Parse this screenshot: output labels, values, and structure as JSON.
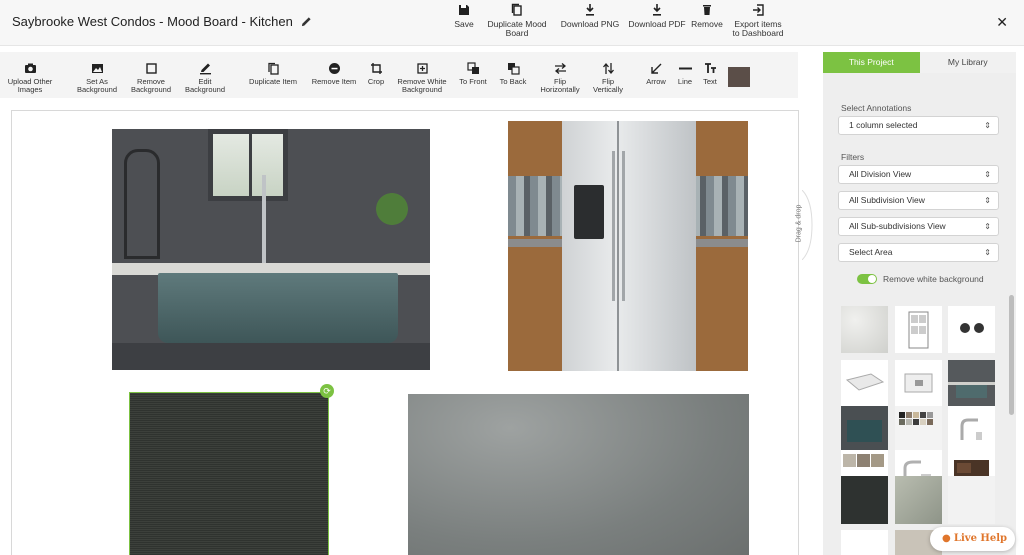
{
  "header": {
    "title": "Saybrooke West Condos - Mood Board - Kitchen",
    "actions": [
      {
        "label": "Save",
        "icon": "save-icon"
      },
      {
        "label": "Duplicate Mood Board",
        "icon": "copy-icon"
      },
      {
        "label": "Download PNG",
        "icon": "download-icon"
      },
      {
        "label": "Download PDF",
        "icon": "download-icon"
      },
      {
        "label": "Remove",
        "icon": "trash-icon"
      },
      {
        "label": "Export items to Dashboard",
        "icon": "export-icon"
      }
    ],
    "close_label": "✕"
  },
  "toolbar": [
    {
      "label": "Upload Other Images",
      "icon": "camera-icon"
    },
    {
      "label": "Set As Background",
      "icon": "image-icon"
    },
    {
      "label": "Remove Background",
      "icon": "square-icon"
    },
    {
      "label": "Edit Background",
      "icon": "pencil-icon"
    },
    {
      "label": "Duplicate Item",
      "icon": "copy-icon"
    },
    {
      "label": "Remove Item",
      "icon": "minus-circle-icon"
    },
    {
      "label": "Crop",
      "icon": "crop-icon"
    },
    {
      "label": "Remove White Background",
      "icon": "remove-white-icon"
    },
    {
      "label": "To Front",
      "icon": "to-front-icon"
    },
    {
      "label": "To Back",
      "icon": "to-back-icon"
    },
    {
      "label": "Flip Horizontally",
      "icon": "flip-horizontal-icon"
    },
    {
      "label": "Flip Vertically",
      "icon": "flip-vertical-icon"
    },
    {
      "label": "Arrow",
      "icon": "arrow-icon"
    },
    {
      "label": "Line",
      "icon": "line-icon"
    },
    {
      "label": "Text",
      "icon": "text-icon"
    }
  ],
  "swatch_color": "#5b4e48",
  "drag_label": "Drag & drop",
  "panel": {
    "tabs": [
      "This Project",
      "My Library"
    ],
    "annotations_label": "Select Annotations",
    "annotations_value": "1 column selected",
    "filters_label": "Filters",
    "filters": [
      "All Division View",
      "All Subdivision View",
      "All Sub-subdivisions View",
      "Select Area"
    ],
    "toggle_label": "Remove white background"
  },
  "live_help": "Live Help",
  "colors": {
    "accent": "#7cc242",
    "live_help": "#e0762c"
  }
}
